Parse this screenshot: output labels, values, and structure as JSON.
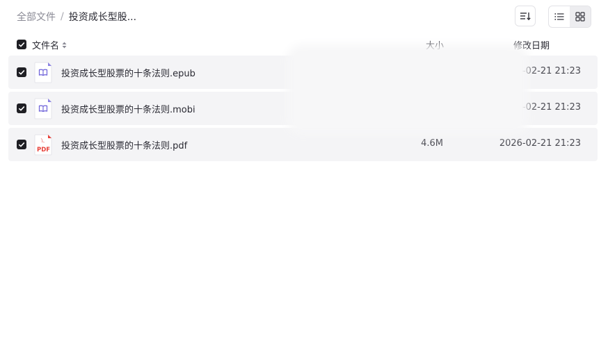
{
  "breadcrumb": {
    "root": "全部文件",
    "separator": "/",
    "current": "投资成长型股..."
  },
  "toolbar": {
    "sort_icon": "sort-lines-icon",
    "view_list_icon": "list-view-icon",
    "view_grid_icon": "grid-view-icon",
    "active_view": "list"
  },
  "table": {
    "columns": {
      "name": "文件名",
      "size": "大小",
      "date": "修改日期"
    },
    "select_all_checked": true,
    "rows": [
      {
        "name": "投资成长型股票的十条法则.epub",
        "size": "",
        "date": "26-02-21 21:23",
        "icon": "ebook-icon",
        "checked": true
      },
      {
        "name": "投资成长型股票的十条法则.mobi",
        "size": "",
        "date": "26-02-21 21:23",
        "icon": "ebook-icon",
        "checked": true
      },
      {
        "name": "投资成长型股票的十条法则.pdf",
        "size": "4.6M",
        "date": "2026-02-21 21:23",
        "icon": "pdf-icon",
        "icon_label": "PDF",
        "checked": true
      }
    ]
  },
  "colors": {
    "ebook_accent": "#6b5fd8",
    "pdf_accent": "#e8413a",
    "row_bg": "#f4f4f6",
    "checkbox": "#1f1f24"
  }
}
